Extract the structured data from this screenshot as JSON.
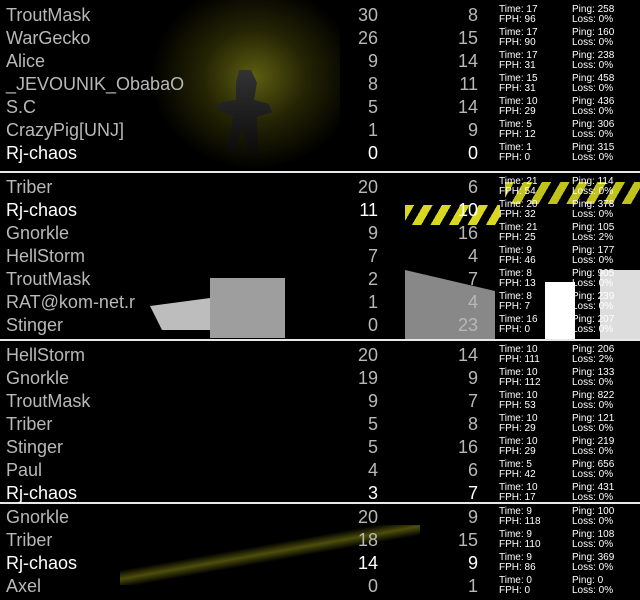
{
  "panels": [
    {
      "rows": [
        {
          "name": "TroutMask",
          "frags": "30",
          "deaths": "8",
          "time": "Time: 17",
          "ping": "Ping: 258",
          "fph": "FPH: 96",
          "loss": "Loss: 0%",
          "highlight": false
        },
        {
          "name": "WarGecko",
          "frags": "26",
          "deaths": "15",
          "time": "Time: 17",
          "ping": "Ping: 160",
          "fph": "FPH: 90",
          "loss": "Loss: 0%",
          "highlight": false
        },
        {
          "name": "Alice",
          "frags": "9",
          "deaths": "14",
          "time": "Time: 17",
          "ping": "Ping: 238",
          "fph": "FPH: 31",
          "loss": "Loss: 0%",
          "highlight": false
        },
        {
          "name": "_JEVOUNIK_ObabaO",
          "frags": "8",
          "deaths": "11",
          "time": "Time: 15",
          "ping": "Ping: 458",
          "fph": "FPH: 31",
          "loss": "Loss: 0%",
          "highlight": false
        },
        {
          "name": "S.C",
          "frags": "5",
          "deaths": "14",
          "time": "Time: 10",
          "ping": "Ping: 436",
          "fph": "FPH: 29",
          "loss": "Loss: 0%",
          "highlight": false
        },
        {
          "name": "CrazyPig[UNJ]",
          "frags": "1",
          "deaths": "9",
          "time": "Time: 5",
          "ping": "Ping: 306",
          "fph": "FPH: 12",
          "loss": "Loss: 0%",
          "highlight": false
        },
        {
          "name": "Rj-chaos",
          "frags": "0",
          "deaths": "0",
          "time": "Time: 1",
          "ping": "Ping: 315",
          "fph": "FPH: 0",
          "loss": "Loss: 0%",
          "highlight": true
        }
      ]
    },
    {
      "rows": [
        {
          "name": "Triber",
          "frags": "20",
          "deaths": "6",
          "time": "Time: 21",
          "ping": "Ping: 114",
          "fph": "FPH: 54",
          "loss": "Loss: 0%",
          "highlight": false
        },
        {
          "name": "Rj-chaos",
          "frags": "11",
          "deaths": "10",
          "time": "Time: 20",
          "ping": "Ping: 378",
          "fph": "FPH: 32",
          "loss": "Loss: 0%",
          "highlight": true
        },
        {
          "name": "Gnorkle",
          "frags": "9",
          "deaths": "16",
          "time": "Time: 21",
          "ping": "Ping: 105",
          "fph": "FPH: 25",
          "loss": "Loss: 2%",
          "highlight": false
        },
        {
          "name": "HellStorm",
          "frags": "7",
          "deaths": "4",
          "time": "Time: 9",
          "ping": "Ping: 177",
          "fph": "FPH: 46",
          "loss": "Loss: 0%",
          "highlight": false
        },
        {
          "name": "TroutMask",
          "frags": "2",
          "deaths": "7",
          "time": "Time: 8",
          "ping": "Ping: 905",
          "fph": "FPH: 13",
          "loss": "Loss: 0%",
          "highlight": false
        },
        {
          "name": "RAT@kom-net.r",
          "frags": "1",
          "deaths": "4",
          "time": "Time: 8",
          "ping": "Ping: 239",
          "fph": "FPH: 7",
          "loss": "Loss: 0%",
          "highlight": false
        },
        {
          "name": "Stinger",
          "frags": "0",
          "deaths": "23",
          "time": "Time: 16",
          "ping": "Ping: 207",
          "fph": "FPH: 0",
          "loss": "Loss: 0%",
          "highlight": false
        }
      ]
    },
    {
      "rows": [
        {
          "name": "HellStorm",
          "frags": "20",
          "deaths": "14",
          "time": "Time: 10",
          "ping": "Ping: 206",
          "fph": "FPH: 111",
          "loss": "Loss: 2%",
          "highlight": false
        },
        {
          "name": "Gnorkle",
          "frags": "19",
          "deaths": "9",
          "time": "Time: 10",
          "ping": "Ping: 133",
          "fph": "FPH: 112",
          "loss": "Loss: 0%",
          "highlight": false
        },
        {
          "name": "TroutMask",
          "frags": "9",
          "deaths": "7",
          "time": "Time: 10",
          "ping": "Ping: 822",
          "fph": "FPH: 53",
          "loss": "Loss: 0%",
          "highlight": false
        },
        {
          "name": "Triber",
          "frags": "5",
          "deaths": "8",
          "time": "Time: 10",
          "ping": "Ping: 121",
          "fph": "FPH: 29",
          "loss": "Loss: 0%",
          "highlight": false
        },
        {
          "name": "Stinger",
          "frags": "5",
          "deaths": "16",
          "time": "Time: 10",
          "ping": "Ping: 219",
          "fph": "FPH: 29",
          "loss": "Loss: 0%",
          "highlight": false
        },
        {
          "name": "Paul",
          "frags": "4",
          "deaths": "6",
          "time": "Time: 5",
          "ping": "Ping: 656",
          "fph": "FPH: 42",
          "loss": "Loss: 0%",
          "highlight": false
        },
        {
          "name": "Rj-chaos",
          "frags": "3",
          "deaths": "7",
          "time": "Time: 10",
          "ping": "Ping: 431",
          "fph": "FPH: 17",
          "loss": "Loss: 0%",
          "highlight": true
        }
      ]
    },
    {
      "rows": [
        {
          "name": "Gnorkle",
          "frags": "20",
          "deaths": "9",
          "time": "Time: 9",
          "ping": "Ping: 100",
          "fph": "FPH: 118",
          "loss": "Loss: 0%",
          "highlight": false
        },
        {
          "name": "Triber",
          "frags": "18",
          "deaths": "15",
          "time": "Time: 9",
          "ping": "Ping: 108",
          "fph": "FPH: 110",
          "loss": "Loss: 0%",
          "highlight": false
        },
        {
          "name": "Rj-chaos",
          "frags": "14",
          "deaths": "9",
          "time": "Time: 9",
          "ping": "Ping: 369",
          "fph": "FPH: 86",
          "loss": "Loss: 0%",
          "highlight": true
        },
        {
          "name": "Axel",
          "frags": "0",
          "deaths": "1",
          "time": "Time: 0",
          "ping": "Ping: 0",
          "fph": "FPH: 0",
          "loss": "Loss: 0%",
          "highlight": false
        }
      ]
    }
  ]
}
